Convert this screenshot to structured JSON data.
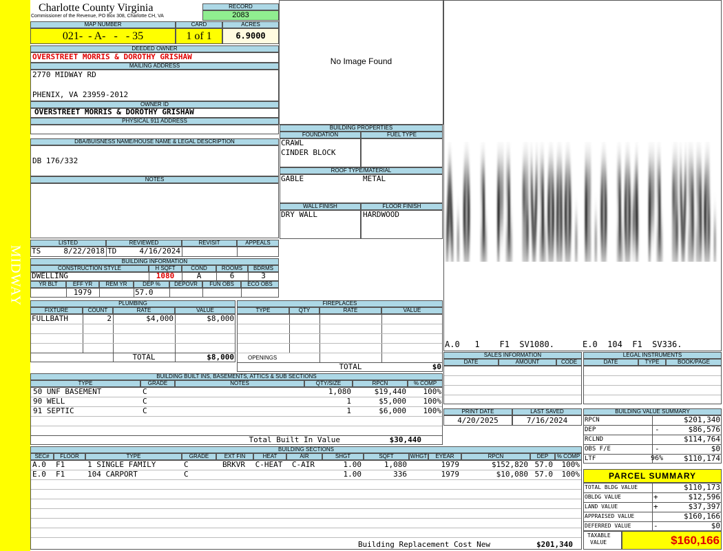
{
  "sidebar": {
    "label": "MIDWAY"
  },
  "header": {
    "county": "Charlotte County Virginia",
    "subtitle": "Commissioner of the Revenue, PO Box 308, Charlotte CH, VA",
    "record_label": "RECORD",
    "record": "2083",
    "map_number_label": "MAP NUMBER",
    "map_number": "021-  - A-   -   - 35",
    "card_label": "CARD",
    "card": "1 of 1",
    "acres_label": "ACRES",
    "acres": "6.9000"
  },
  "owner": {
    "deeded_label": "DEEDED OWNER",
    "deeded": "OVERSTREET MORRIS & DOROTHY GRISHAW",
    "mailing_label": "MAILING ADDRESS",
    "mailing_line1": "2770 MIDWAY RD",
    "mailing_line2": "PHENIX, VA 23959-2012",
    "owner_id_label": "OWNER ID",
    "owner_id": "OVERSTREET MORRIS & DOROTHY GRISHAW",
    "physical_label": "PHYSICAL 911 ADDRESS",
    "physical": ""
  },
  "dba": {
    "label": "DBA/BUISNESS NAME/HOUSE NAME & LEGAL DESCRIPTION",
    "value": "DB 176/332"
  },
  "notes": {
    "label": "NOTES",
    "value": ""
  },
  "photo": {
    "text": "No Image Found"
  },
  "building_properties": {
    "title": "BUILDING PROPERTIES",
    "foundation_label": "FOUNDATION",
    "foundation": [
      "CRAWL",
      "CINDER BLOCK"
    ],
    "fuel_label": "FUEL TYPE",
    "fuel": "",
    "roof_label": "ROOF TYPE/MATERIAL",
    "roof_type": "GABLE",
    "roof_material": "METAL",
    "wall_label": "WALL FINISH",
    "wall": "DRY WALL",
    "floor_label": "FLOOR FINISH",
    "floor": "HARDWOOD"
  },
  "sketch": {
    "line1": "A.0   1    F1  SV1080.",
    "line2": "E.0  104  F1  SV336."
  },
  "status": {
    "listed_label": "LISTED",
    "listed_by": "TS",
    "listed_date": "8/22/2018",
    "reviewed_label": "REVIEWED",
    "reviewed_by": "TD",
    "reviewed_date": "4/16/2024",
    "revisit_label": "REVISIT",
    "revisit": "",
    "appeals_label": "APPEALS",
    "appeals": ""
  },
  "building_info": {
    "title": "BUILDING INFORMATION",
    "style_label": "CONSTRUCTION STYLE",
    "style": "DWELLING",
    "hsqft_label": "H SQFT",
    "hsqft": "1080",
    "cond_label": "COND",
    "cond": "A",
    "rooms_label": "ROOMS",
    "rooms": "6",
    "bdrms_label": "BDRMS",
    "bdrms": "3",
    "yrblt_label": "YR BLT",
    "yrblt": "",
    "effyr_label": "EFF YR",
    "effyr": "1979",
    "remyr_label": "REM YR",
    "remyr": "",
    "dep_label": "DEP %",
    "dep": "57.0",
    "depovr_label": "DEPOVR",
    "depovr": "",
    "funobs_label": "FUN OBS",
    "funobs": "",
    "ecoobs_label": "ECO OBS",
    "ecoobs": ""
  },
  "plumbing": {
    "title": "PLUMBING",
    "headers": [
      "FIXTURE",
      "COUNT",
      "RATE",
      "VALUE"
    ],
    "rows": [
      [
        "FULLBATH",
        "2",
        "$4,000",
        "$8,000"
      ]
    ],
    "total_label": "TOTAL",
    "total": "$8,000"
  },
  "fireplaces": {
    "title": "FIREPLACES",
    "headers": [
      "TYPE",
      "QTY",
      "RATE",
      "VALUE"
    ],
    "openings_label": "OPENINGS",
    "total_label": "TOTAL",
    "total": "$0"
  },
  "builtins": {
    "title": "BUILDING BUILT INS, BASEMENTS, ATTICS & SUB SECTIONS",
    "headers": [
      "TYPE",
      "GRADE",
      "NOTES",
      "QTY/SIZE",
      "RPCN",
      "% COMP"
    ],
    "rows": [
      [
        "50 UNF BASEMENT",
        "C",
        "",
        "1,080",
        "$19,440",
        "100%"
      ],
      [
        "90 WELL",
        "C",
        "",
        "1",
        "$5,000",
        "100%"
      ],
      [
        "91 SEPTIC",
        "C",
        "",
        "1",
        "$6,000",
        "100%"
      ]
    ],
    "total_label": "Total Built In Value",
    "total": "$30,440"
  },
  "sales": {
    "title": "SALES INFORMATION",
    "headers": [
      "DATE",
      "AMOUNT",
      "CODE"
    ]
  },
  "legal": {
    "title": "LEGAL INSTRUMENTS",
    "headers": [
      "DATE",
      "TYPE",
      "BOOK/PAGE"
    ]
  },
  "dates": {
    "print_label": "PRINT DATE",
    "print": "4/20/2025",
    "saved_label": "LAST SAVED",
    "saved": "7/16/2024"
  },
  "value_summary": {
    "title": "BUILDING VALUE SUMMARY",
    "rows": [
      {
        "label": "RPCN",
        "pct": "",
        "sign": "",
        "value": "$201,340"
      },
      {
        "label": "DEP",
        "pct": "",
        "sign": "-",
        "value": "$86,576"
      },
      {
        "label": "RCLND",
        "pct": "",
        "sign": "",
        "value": "$114,764"
      },
      {
        "label": "OBS F/E",
        "pct": "",
        "sign": "-",
        "value": "$0"
      },
      {
        "label": "LTF",
        "pct": "96%",
        "sign": "",
        "value": "$110,174"
      }
    ]
  },
  "parcel_summary": {
    "title": "PARCEL SUMMARY",
    "rows": [
      {
        "label": "TOTAL BLDG VALUE",
        "sign": "",
        "value": "$110,173"
      },
      {
        "label": "OBLDG VALUE",
        "sign": "+",
        "value": "$12,596"
      },
      {
        "label": "LAND VALUE",
        "sign": "+",
        "value": "$37,397"
      },
      {
        "label": "APPRAISED VALUE",
        "sign": "",
        "value": "$160,166"
      },
      {
        "label": "DEFERRED VALUE",
        "sign": "-",
        "value": "$0"
      }
    ],
    "taxable_label_1": "TAXABLE",
    "taxable_label_2": "VALUE",
    "taxable": "$160,166"
  },
  "sections": {
    "title": "BUILDING SECTIONS",
    "headers": [
      "SEC#",
      "FLOOR",
      "TYPE",
      "GRADE",
      "EXT FIN",
      "HEAT",
      "AIR",
      "SHGT",
      "SQFT",
      "WHGT",
      "EYEAR",
      "RPCN",
      "DEP",
      "% COMP"
    ],
    "rows": [
      [
        "A.0",
        "F1",
        "1 SINGLE FAMILY",
        "C",
        "BRKVR",
        "C-HEAT",
        "C-AIR",
        "1.00",
        "1,080",
        "",
        "1979",
        "$152,820",
        "57.0",
        "100%"
      ],
      [
        "E.0",
        "F1",
        "104 CARPORT",
        "C",
        "",
        "",
        "",
        "1.00",
        "336",
        "",
        "1979",
        "$10,080",
        "57.0",
        "100%"
      ]
    ],
    "total_label": "Building Replacement Cost New",
    "total": "$201,340"
  }
}
